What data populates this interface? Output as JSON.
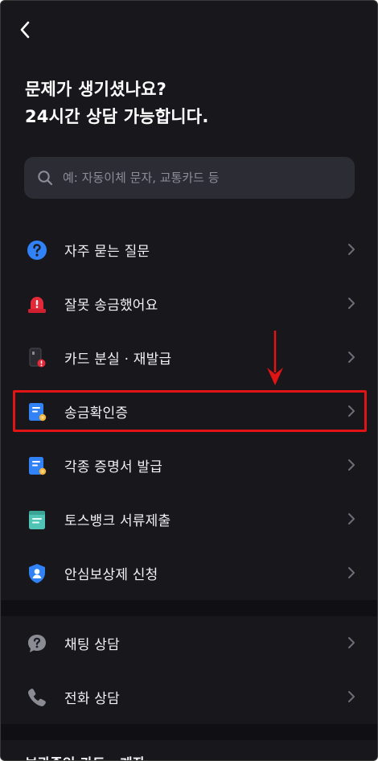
{
  "header": {
    "title_line1": "문제가 생기셨나요?",
    "title_line2": "24시간 상담 가능합니다."
  },
  "search": {
    "placeholder": "예: 자동이체 문자, 교통카드 등"
  },
  "menu_items": [
    {
      "label": "자주 묻는 질문",
      "icon": "question-circle-icon"
    },
    {
      "label": "잘못 송금했어요",
      "icon": "alert-siren-icon"
    },
    {
      "label": "카드 분실 · 재발급",
      "icon": "card-lost-icon"
    },
    {
      "label": "송금확인증",
      "icon": "certificate-icon"
    },
    {
      "label": "각종 증명서 발급",
      "icon": "certificate-icon"
    },
    {
      "label": "토스뱅크 서류제출",
      "icon": "document-submit-icon"
    },
    {
      "label": "안심보상제 신청",
      "icon": "shield-user-icon"
    }
  ],
  "contact_items": [
    {
      "label": "채팅 상담",
      "icon": "chat-question-icon"
    },
    {
      "label": "전화 상담",
      "icon": "phone-icon"
    }
  ],
  "bottom": {
    "section_title": "보관중인 카드 ∙ 계좌"
  },
  "colors": {
    "background": "#17171c",
    "search_bg": "#2c2c35",
    "accent_blue": "#3182f6",
    "alert_red": "#e42939",
    "annotation_red": "#e01414",
    "teal": "#4fc3b4"
  }
}
